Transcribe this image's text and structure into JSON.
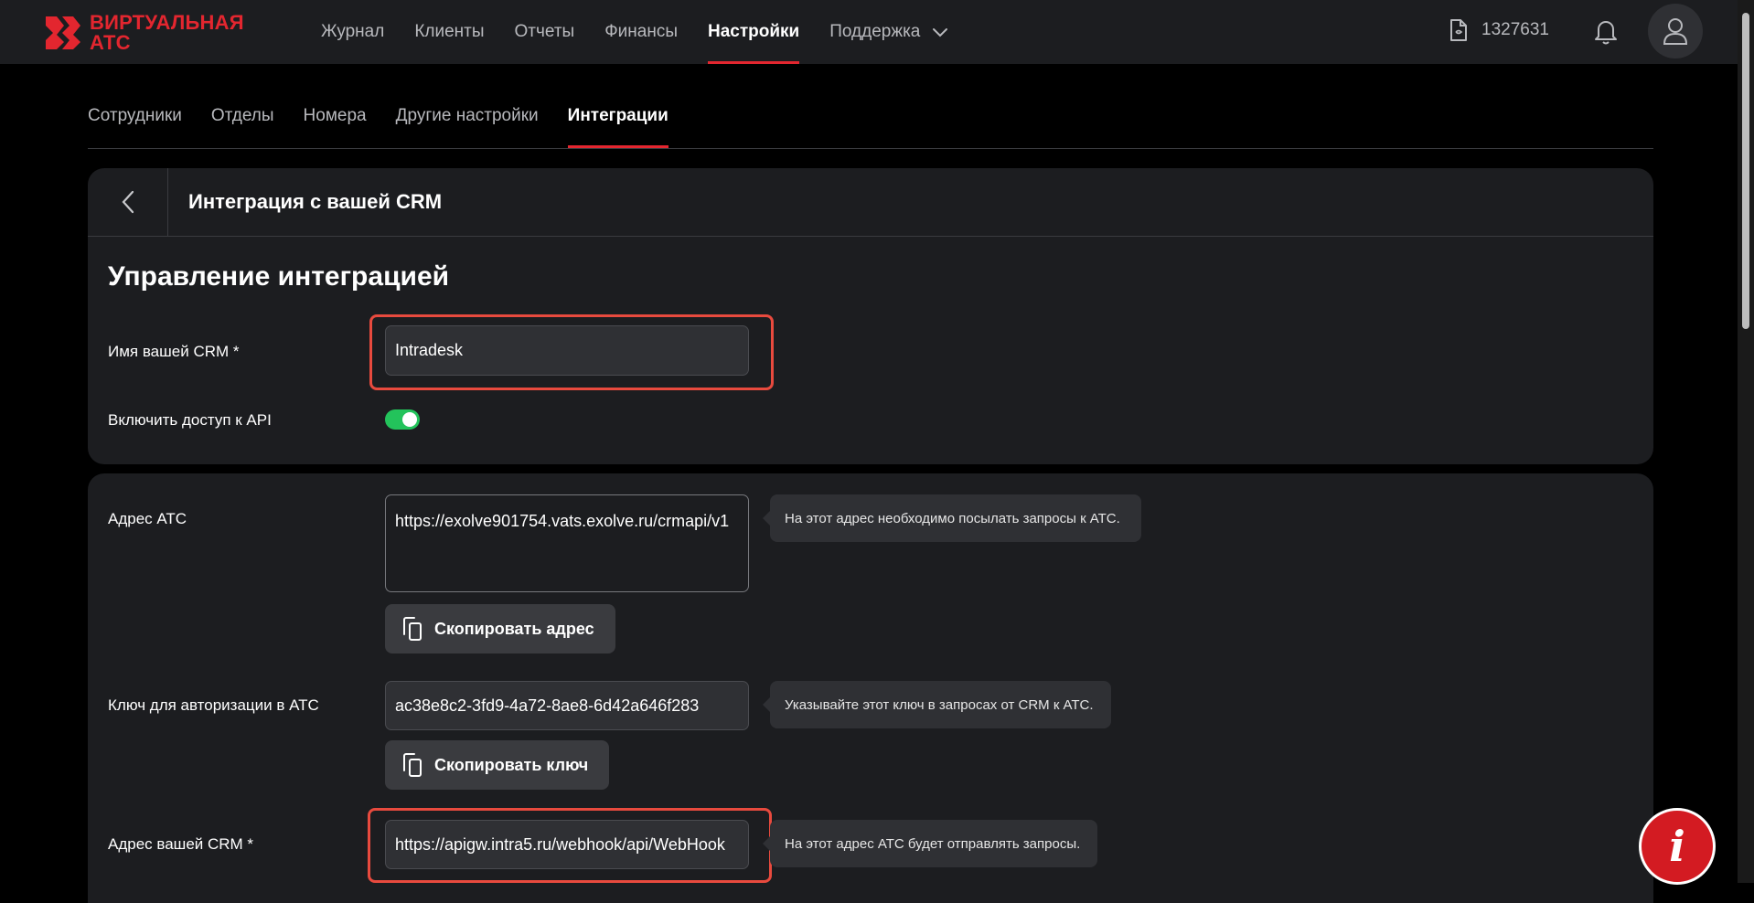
{
  "brand": {
    "line1": "ВИРТУАЛЬНАЯ",
    "line2": "АТС",
    "color": "#e3262f"
  },
  "nav": {
    "items": [
      {
        "label": "Журнал"
      },
      {
        "label": "Клиенты"
      },
      {
        "label": "Отчеты"
      },
      {
        "label": "Финансы"
      },
      {
        "label": "Настройки",
        "active": true
      },
      {
        "label": "Поддержка",
        "dropdown": true
      }
    ]
  },
  "account": {
    "number": "1327631",
    "icon": "document-icon"
  },
  "subtabs": [
    {
      "label": "Сотрудники"
    },
    {
      "label": "Отделы"
    },
    {
      "label": "Номера"
    },
    {
      "label": "Другие настройки"
    },
    {
      "label": "Интеграции",
      "active": true
    }
  ],
  "integration": {
    "header_title": "Интеграция с вашей CRM",
    "section_title": "Управление интеграцией",
    "crm_name": {
      "label": "Имя вашей CRM *",
      "value": "Intradesk"
    },
    "api_access": {
      "label": "Включить доступ к API",
      "enabled": true
    }
  },
  "details": {
    "ats_address": {
      "label": "Адрес АТС",
      "value": "https://exolve901754.vats.exolve.ru/crmapi/v1",
      "tooltip": "На этот адрес необходимо посылать запросы к АТС.",
      "copy_label": "Скопировать адрес"
    },
    "auth_key": {
      "label": "Ключ для авторизации в АТС",
      "value": "ac38e8c2-3fd9-4a72-8ae8-6d42a646f283",
      "tooltip": "Указывайте этот ключ в запросах от CRM к АТС.",
      "copy_label": "Скопировать ключ"
    },
    "crm_address": {
      "label": "Адрес вашей CRM *",
      "value": "https://apigw.intra5.ru/webhook/api/WebHook",
      "tooltip": "На этот адрес АТС будет отправлять запросы."
    }
  },
  "colors": {
    "accent": "#e3262f",
    "highlight": "#e84a3e",
    "toggle_on": "#23c35b"
  }
}
